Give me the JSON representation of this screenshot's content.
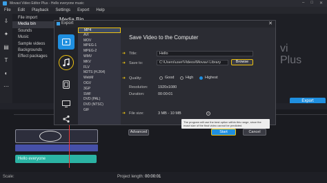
{
  "window": {
    "title": "Movavi Video Editor Plus - Hello everyone music",
    "minimize": "–",
    "maximize": "□",
    "close": "✕"
  },
  "menu": [
    "File",
    "Edit",
    "Playback",
    "Settings",
    "Export",
    "Help"
  ],
  "sidebar": {
    "items": [
      {
        "label": "File import"
      },
      {
        "label": "Media bin",
        "active": true
      },
      {
        "label": "Sounds"
      },
      {
        "label": "Music"
      },
      {
        "label": "Sample videos"
      },
      {
        "label": "Backgrounds"
      },
      {
        "label": "Effect packages"
      }
    ]
  },
  "media_bin_title": "Media Bin",
  "preview_overlay": {
    "line1": "vi",
    "line2": "Plus"
  },
  "export_button_label": "Export",
  "timeline": {
    "music_clip": "Hello everyone",
    "scale_label": "Scale:",
    "project_length_label": "Project length:",
    "project_length_value": "00:00:01"
  },
  "dialog": {
    "title": "Export",
    "close": "✕",
    "categories": [
      {
        "name": "video",
        "icon": "play-icon",
        "active": true
      },
      {
        "name": "audio",
        "icon": "music-note-icon",
        "highlighted": true
      },
      {
        "name": "devices",
        "icon": "tablet-icon"
      },
      {
        "name": "tv",
        "icon": "monitor-icon"
      },
      {
        "name": "share",
        "icon": "share-icon"
      }
    ],
    "formats": [
      "MP4",
      "AVI",
      "MOV",
      "MPEG-1",
      "MPEG-2",
      "WMV",
      "MKV",
      "FLV",
      "M2TS (H.264)",
      "WebM",
      "OGV",
      "3GP",
      "SWF",
      "DVD (PAL)",
      "DVD (NTSC)",
      "GIF"
    ],
    "selected_format": "MP4",
    "heading": "Save Video to the Computer",
    "title_label": "Title:",
    "title_value": "Hello",
    "save_to_label": "Save to:",
    "save_to_value": "C:\\Users\\user\\Videos\\Movavi Library",
    "browse_label": "Browse",
    "quality_label": "Quality:",
    "quality_options": [
      "Good",
      "High",
      "Highest"
    ],
    "quality_selected": "Highest",
    "resolution_label": "Resolution:",
    "resolution_value": "1920x1080",
    "duration_label": "Duration:",
    "duration_value": "00:00:01",
    "file_size_label": "File size:",
    "file_size_value": "3 MB - 10 MB",
    "tooltip": "The program will use the best option within this range, since the exact size of the final video cannot be predicted.",
    "advanced_label": "Advanced",
    "start_label": "Start",
    "cancel_label": "Cancel"
  },
  "colors": {
    "accent": "#1f8fe0",
    "highlight": "#f1c40f",
    "music_clip": "#2bb3a4"
  }
}
